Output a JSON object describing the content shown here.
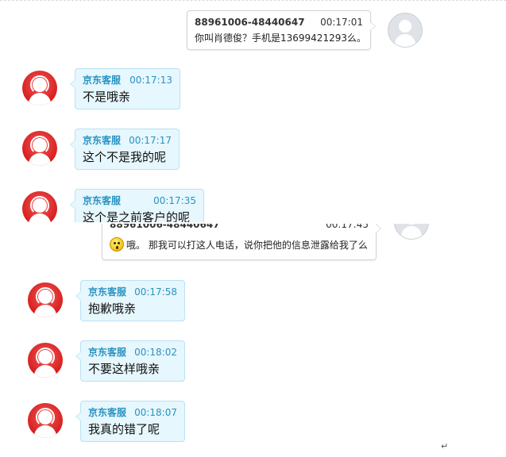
{
  "messages": [
    {
      "sender": "88961006-48440647",
      "time": "00:17:01",
      "text": "你叫肖德俊？手机是13699421293么。"
    },
    {
      "sender": "京东客服",
      "time": "00:17:13",
      "text": "不是哦亲"
    },
    {
      "sender": "京东客服",
      "time": "00:17:17",
      "text": "这个不是我的呢"
    },
    {
      "sender": "京东客服",
      "time": "00:17:35",
      "text": "这个是之前客户的呢"
    },
    {
      "sender": "88961006-48440647",
      "time": "00:17:45",
      "text": "哦。 那我可以打这人电话，说你把他的信息泄露给我了么"
    },
    {
      "sender": "京东客服",
      "time": "00:17:58",
      "text": "抱歉哦亲"
    },
    {
      "sender": "京东客服",
      "time": "00:18:02",
      "text": "不要这样哦亲"
    },
    {
      "sender": "京东客服",
      "time": "00:18:07",
      "text": "我真的错了呢"
    }
  ],
  "icons": {
    "agent_avatar": "headset-agent-icon",
    "user_avatar": "default-user-icon",
    "emoji": "surprised-emoji-icon"
  },
  "colors": {
    "agent_bubble": "#e6f7fd",
    "agent_name": "#2a93c1",
    "agent_avatar": "#d81e1e"
  },
  "footer": {
    "paragraph_mark": "↵"
  }
}
